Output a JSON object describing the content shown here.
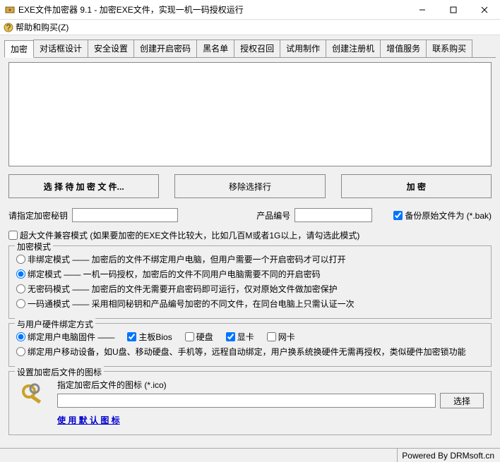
{
  "window": {
    "title": "EXE文件加密器 9.1 - 加密EXE文件，实现一机一码授权运行"
  },
  "menu": {
    "help_buy": "帮助和购买(Z)"
  },
  "tabs": [
    "加密",
    "对话框设计",
    "安全设置",
    "创建开启密码",
    "黑名单",
    "授权召回",
    "试用制作",
    "创建注册机",
    "增值服务",
    "联系购买"
  ],
  "buttons": {
    "select_files": "选 择 待 加 密 文 件...",
    "remove_selected": "移除选择行",
    "encrypt": "加 密",
    "choose_icon": "选择"
  },
  "labels": {
    "secret_key": "请指定加密秘钥",
    "product_id": "产品编号",
    "backup_original": "备份原始文件为 (*.bak)",
    "large_file_mode": "超大文件兼容模式 (如果要加密的EXE文件比较大，比如几百M或者1G以上，请勾选此模式)",
    "encrypt_mode_legend": "加密模式",
    "mode_unbound": "非绑定模式 —— 加密后的文件不绑定用户电脑，但用户需要一个开启密码才可以打开",
    "mode_bound": "绑定模式 —— 一机一码授权，加密后的文件不同用户电脑需要不同的开启密码",
    "mode_nopass": "无密码模式 —— 加密后的文件无需要开启密码即可运行，仅对原始文件做加密保护",
    "mode_onepass": "一码通模式 —— 采用相同秘钥和产品编号加密的不同文件，在同台电脑上只需认证一次",
    "hw_bind_legend": "与用户硬件绑定方式",
    "hw_firmware": "绑定用户电脑固件 ——",
    "hw_bios": "主板Bios",
    "hw_disk": "硬盘",
    "hw_gpu": "显卡",
    "hw_nic": "网卡",
    "hw_mobile": "绑定用户移动设备，如U盘、移动硬盘、手机等，远程自动绑定，用户换系统换硬件无需再授权，类似硬件加密锁功能",
    "icon_legend": "设置加密后文件的图标",
    "icon_hint": "指定加密后文件的图标 (*.ico)",
    "use_default_icon": "使 用 默 认 图 标"
  },
  "values": {
    "secret_key": "",
    "product_id": "",
    "backup_checked": true,
    "large_file_checked": false,
    "mode_selected": "bound",
    "hw_bind_type": "firmware",
    "hw_bios": true,
    "hw_disk": false,
    "hw_gpu": true,
    "hw_nic": false,
    "icon_path": ""
  },
  "status": {
    "powered": "Powered By DRMsoft.cn"
  }
}
